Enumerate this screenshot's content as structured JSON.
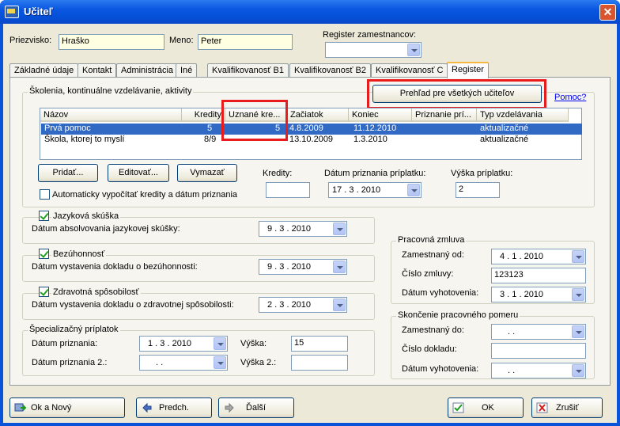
{
  "window": {
    "title": "Učiteľ",
    "close": "✕"
  },
  "header": {
    "surname_label": "Priezvisko:",
    "surname_value": "Hraško",
    "name_label": "Meno:",
    "name_value": "Peter",
    "register_label": "Register zamestnancov:",
    "register_value": ""
  },
  "tabs": [
    {
      "label": "Základné údaje"
    },
    {
      "label": "Kontakt"
    },
    {
      "label": "Administrácia"
    },
    {
      "label": "Iné"
    },
    {
      "label": "Kvalifikovanosť B1"
    },
    {
      "label": "Kvalifikovanosť B2"
    },
    {
      "label": "Kvalifikovanosť C"
    },
    {
      "label": "Register"
    }
  ],
  "trainings": {
    "group_label": "Školenia, kontinuálne vzdelávanie, aktivity",
    "overview_button": "Prehľad pre všetkých učiteľov",
    "help_link": "Pomoc?",
    "columns": [
      "Názov",
      "Kredity",
      "Uznané kre...",
      "Začiatok",
      "Koniec",
      "Priznanie prí...",
      "Typ vzdelávania"
    ],
    "rows": [
      {
        "name": "Prvá pomoc",
        "credits": "5",
        "recognized": "5",
        "start": "4.8.2009",
        "end": "11.12.2010",
        "granted": "",
        "type": "aktualizačné"
      },
      {
        "name": "Škola, ktorej to myslí",
        "credits": "8/9",
        "recognized": "",
        "start": "13.10.2009",
        "end": "1.3.2010",
        "granted": "",
        "type": "aktualizačné"
      }
    ],
    "add_button": "Pridať...",
    "edit_button": "Editovať...",
    "delete_button": "Vymazať",
    "auto_label": "Automaticky vypočítať kredity a dátum priznania",
    "credits_label": "Kredity:",
    "credits_value": "",
    "grant_date_label": "Dátum priznania príplatku:",
    "grant_date_value": "17 .  3 . 2010",
    "bonus_label": "Výška príplatku:",
    "bonus_value": "2"
  },
  "language": {
    "check_label": "Jazyková skúška",
    "date_label": "Dátum absolvovania jazykovej skúšky:",
    "date_value": "9 .  3 . 2010"
  },
  "integrity": {
    "check_label": "Bezúhonnosť",
    "date_label": "Dátum vystavenia dokladu o bezúhonnosti:",
    "date_value": "9 .  3 . 2010"
  },
  "health": {
    "check_label": "Zdravotná spôsobilosť",
    "date_label": "Dátum vystavenia dokladu o zdravotnej spôsobilosti:",
    "date_value": "2 .  3 . 2010"
  },
  "special": {
    "group_label": "Špecializačný príplatok",
    "date_label": "Dátum priznania:",
    "date_value": "1 .  3 . 2010",
    "amount_label": "Výška:",
    "amount_value": "15",
    "date2_label": "Dátum priznania 2.:",
    "date2_value": " .    .",
    "amount2_label": "Výška 2.:",
    "amount2_value": ""
  },
  "contract": {
    "group_label": "Pracovná zmluva",
    "employed_label": "Zamestnaný od:",
    "employed_value": "4 .  1 . 2010",
    "number_label": "Číslo zmluvy:",
    "number_value": "123123",
    "issue_label": "Dátum vyhotovenia:",
    "issue_value": "3 .  1 . 2010"
  },
  "termination": {
    "group_label": "Skončenie pracovného pomeru",
    "employed_label": "Zamestnaný do:",
    "employed_value": " .    .",
    "doc_label": "Číslo dokladu:",
    "doc_value": "",
    "issue_label": "Dátum vyhotovenia:",
    "issue_value": " .    ."
  },
  "footer": {
    "ok_new": "Ok a Nový",
    "prev": "Predch.",
    "next": "Ďalší",
    "ok": "OK",
    "cancel": "Zrušiť"
  }
}
